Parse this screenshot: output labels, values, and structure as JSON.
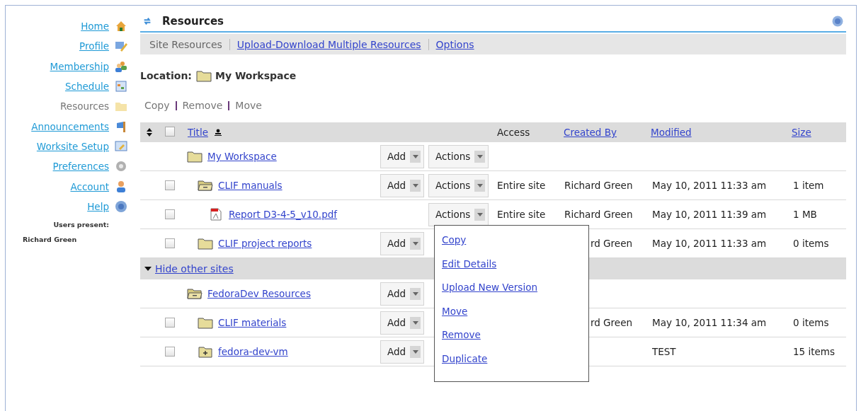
{
  "sidebar": {
    "items": [
      {
        "label": "Home",
        "selected": false
      },
      {
        "label": "Profile",
        "selected": false
      },
      {
        "label": "Membership",
        "selected": false
      },
      {
        "label": "Schedule",
        "selected": false
      },
      {
        "label": "Resources",
        "selected": true
      },
      {
        "label": "Announcements",
        "selected": false
      },
      {
        "label": "Worksite Setup",
        "selected": false
      },
      {
        "label": "Preferences",
        "selected": false
      },
      {
        "label": "Account",
        "selected": false
      },
      {
        "label": "Help",
        "selected": false
      }
    ],
    "users_present_label": "Users present:",
    "users": [
      "Richard Green"
    ]
  },
  "tool": {
    "title": "Resources"
  },
  "tabs": [
    {
      "label": "Site Resources",
      "selected": true
    },
    {
      "label": "Upload-Download Multiple Resources",
      "selected": false
    },
    {
      "label": "Options",
      "selected": false
    }
  ],
  "location": {
    "label": "Location:",
    "value": "My Workspace"
  },
  "actions": [
    "Copy",
    "Remove",
    "Move"
  ],
  "table": {
    "select_all": {
      "checked": false
    },
    "columns": [
      {
        "label": "Title",
        "link": true,
        "sorted": true
      },
      {
        "label": "Access",
        "link": false,
        "sorted": false
      },
      {
        "label": "Created By",
        "link": true,
        "sorted": false
      },
      {
        "label": "Modified",
        "link": true,
        "sorted": false
      },
      {
        "label": "Size",
        "link": true,
        "sorted": false
      }
    ],
    "sections": [
      {
        "rows": [
          {
            "kind": "folder",
            "title": "My Workspace",
            "add": "Add",
            "actions": "Actions",
            "children": [
              {
                "kind": "open-folder",
                "title": "CLIF manuals",
                "checked": false,
                "add": "Add",
                "actions": "Actions",
                "access": "Entire site",
                "created_by": "Richard Green",
                "modified": "May 10, 2011 11:33 am",
                "size": "1 item",
                "children": [
                  {
                    "kind": "pdf",
                    "title": "Report D3-4-5_v10.pdf",
                    "checked": false,
                    "actions": "Actions",
                    "access": "Entire site",
                    "created_by": "Richard Green",
                    "modified": "May 10, 2011 11:39 am",
                    "size": "1 MB"
                  }
                ]
              },
              {
                "kind": "folder",
                "title": "CLIF project reports",
                "checked": false,
                "add": "Add",
                "created_by": "rd Green",
                "modified": "May 10, 2011 11:33 am",
                "size": "0 items"
              }
            ]
          }
        ]
      },
      {
        "toggle": {
          "label": "Hide other sites",
          "expanded": true
        },
        "rows": [
          {
            "kind": "open-folder",
            "title": "FedoraDev Resources",
            "add": "Add",
            "children": [
              {
                "kind": "folder",
                "title": "CLIF materials",
                "checked": false,
                "add": "Add",
                "created_by": "rd Green",
                "modified": "May 10, 2011 11:34 am",
                "size": "0 items"
              },
              {
                "kind": "package",
                "title": "fedora-dev-vm",
                "checked": false,
                "add": "Add",
                "modified": "TEST",
                "size": "15 items"
              }
            ]
          }
        ]
      }
    ]
  },
  "actions_menu": {
    "items": [
      "Copy",
      "Edit Details",
      "Upload New Version",
      "Move",
      "Remove",
      "Duplicate"
    ]
  }
}
